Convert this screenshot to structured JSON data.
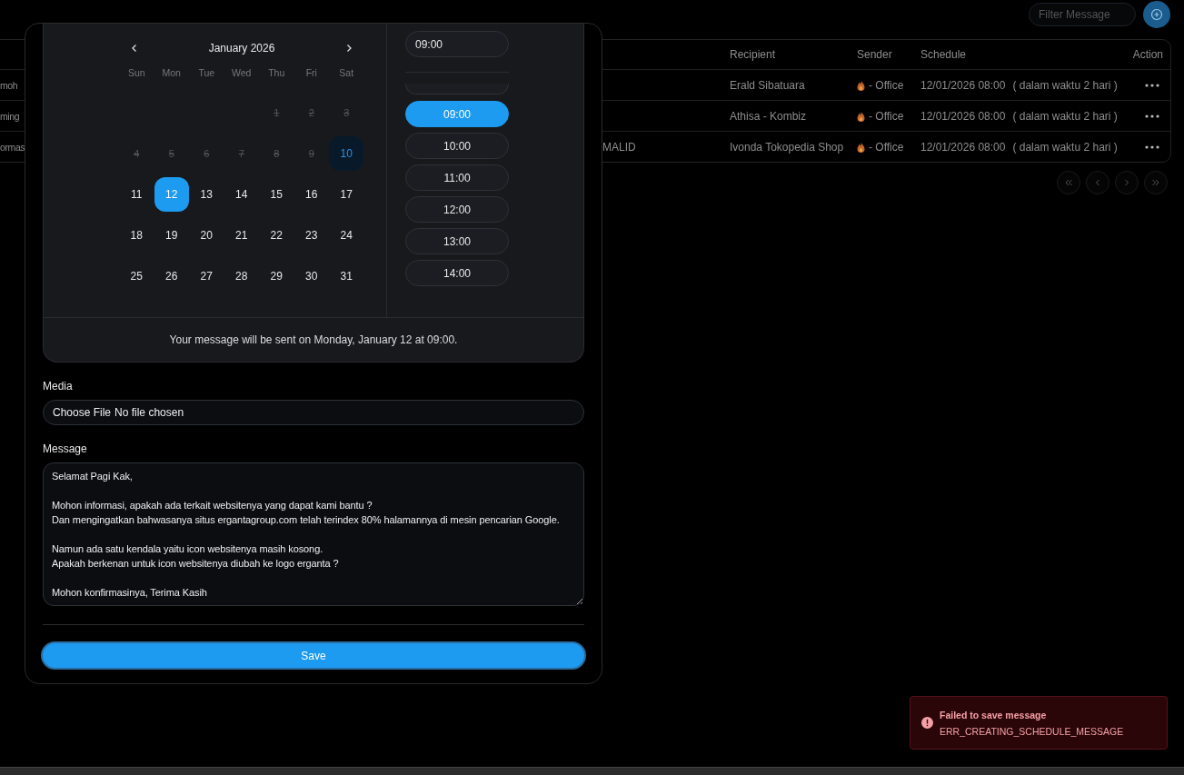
{
  "toolbar": {
    "filter": {
      "placeholder": "Filter Message"
    }
  },
  "table": {
    "columns": [
      "Recipient",
      "Sender",
      "Schedule",
      "Action"
    ],
    "rows": [
      {
        "column_1": "moh",
        "recipient": "Erald Sibatuara",
        "sender": "- Office",
        "schedule": "12/01/2026 08:00",
        "schedule_note": "( dalam waktu 2 hari )"
      },
      {
        "column_1": "ming",
        "recipient": "Athisa - Kombiz",
        "sender": "- Office",
        "schedule": "12/01/2026 08:00",
        "schedule_note": "( dalam waktu 2 hari )"
      },
      {
        "column_1": "ormas",
        "column_2": "MALID",
        "recipient": "Ivonda Tokopedia Shop",
        "sender": "- Office",
        "schedule": "12/01/2026 08:00",
        "schedule_note": "( dalam waktu 2 hari )"
      }
    ]
  },
  "modal": {
    "calendar": {
      "month": "January 2026",
      "weekdays": [
        "Sun",
        "Mon",
        "Tue",
        "Wed",
        "Thu",
        "Fri",
        "Sat"
      ],
      "weeks": [
        [
          {
            "label": "1",
            "disabled": true,
            "today": false,
            "selected": false
          },
          {
            "label": "2",
            "disabled": true,
            "today": false,
            "selected": false
          },
          {
            "label": "3",
            "disabled": true,
            "today": false,
            "selected": false
          }
        ],
        [
          {
            "label": "4",
            "disabled": true,
            "today": false,
            "selected": false
          },
          {
            "label": "5",
            "disabled": true,
            "today": false,
            "selected": false
          },
          {
            "label": "6",
            "disabled": true,
            "today": false,
            "selected": false
          },
          {
            "label": "7",
            "disabled": true,
            "today": false,
            "selected": false
          },
          {
            "label": "8",
            "disabled": true,
            "today": false,
            "selected": false
          },
          {
            "label": "9",
            "disabled": true,
            "today": false,
            "selected": false
          },
          {
            "label": "10",
            "disabled": false,
            "today": true,
            "selected": false
          }
        ],
        [
          {
            "label": "11",
            "disabled": false,
            "today": false,
            "selected": false
          },
          {
            "label": "12",
            "disabled": false,
            "today": false,
            "selected": true
          },
          {
            "label": "13",
            "disabled": false,
            "today": false,
            "selected": false
          },
          {
            "label": "14",
            "disabled": false,
            "today": false,
            "selected": false
          },
          {
            "label": "15",
            "disabled": false,
            "today": false,
            "selected": false
          },
          {
            "label": "16",
            "disabled": false,
            "today": false,
            "selected": false
          },
          {
            "label": "17",
            "disabled": false,
            "today": false,
            "selected": false
          }
        ],
        [
          {
            "label": "18",
            "disabled": false,
            "today": false,
            "selected": false
          },
          {
            "label": "19",
            "disabled": false,
            "today": false,
            "selected": false
          },
          {
            "label": "20",
            "disabled": false,
            "today": false,
            "selected": false
          },
          {
            "label": "21",
            "disabled": false,
            "today": false,
            "selected": false
          },
          {
            "label": "22",
            "disabled": false,
            "today": false,
            "selected": false
          },
          {
            "label": "23",
            "disabled": false,
            "today": false,
            "selected": false
          },
          {
            "label": "24",
            "disabled": false,
            "today": false,
            "selected": false
          }
        ],
        [
          {
            "label": "25",
            "disabled": false,
            "today": false,
            "selected": false
          },
          {
            "label": "26",
            "disabled": false,
            "today": false,
            "selected": false
          },
          {
            "label": "27",
            "disabled": false,
            "today": false,
            "selected": false
          },
          {
            "label": "28",
            "disabled": false,
            "today": false,
            "selected": false
          },
          {
            "label": "29",
            "disabled": false,
            "today": false,
            "selected": false
          },
          {
            "label": "30",
            "disabled": false,
            "today": false,
            "selected": false
          },
          {
            "label": "31",
            "disabled": false,
            "today": false,
            "selected": false
          }
        ]
      ]
    },
    "time": {
      "value": "09:00",
      "slots": [
        {
          "label": "09:00",
          "selected": true
        },
        {
          "label": "10:00",
          "selected": false
        },
        {
          "label": "11:00",
          "selected": false
        },
        {
          "label": "12:00",
          "selected": false
        },
        {
          "label": "13:00",
          "selected": false
        },
        {
          "label": "14:00",
          "selected": false
        }
      ]
    },
    "summary": "Your message will be sent on Monday, January 12 at 09:00.",
    "media": {
      "label": "Media",
      "button": "Choose File",
      "status": "No file chosen"
    },
    "message": {
      "label": "Message",
      "value": "Selamat Pagi Kak,\n\nMohon informasi, apakah ada terkait websitenya yang dapat kami bantu ?\nDan mengingatkan bahwasanya situs ergantagroup.com telah terindex 80% halamannya di mesin pencarian Google.\n\nNamun ada satu kendala yaitu icon websitenya masih kosong.\nApakah berkenan untuk icon websitenya diubah ke logo erganta ?\n\nMohon konfirmasinya, Terima Kasih"
    },
    "save": "Save"
  },
  "toast": {
    "title": "Failed to save message",
    "message": "ERR_CREATING_SCHEDULE_MESSAGE"
  }
}
